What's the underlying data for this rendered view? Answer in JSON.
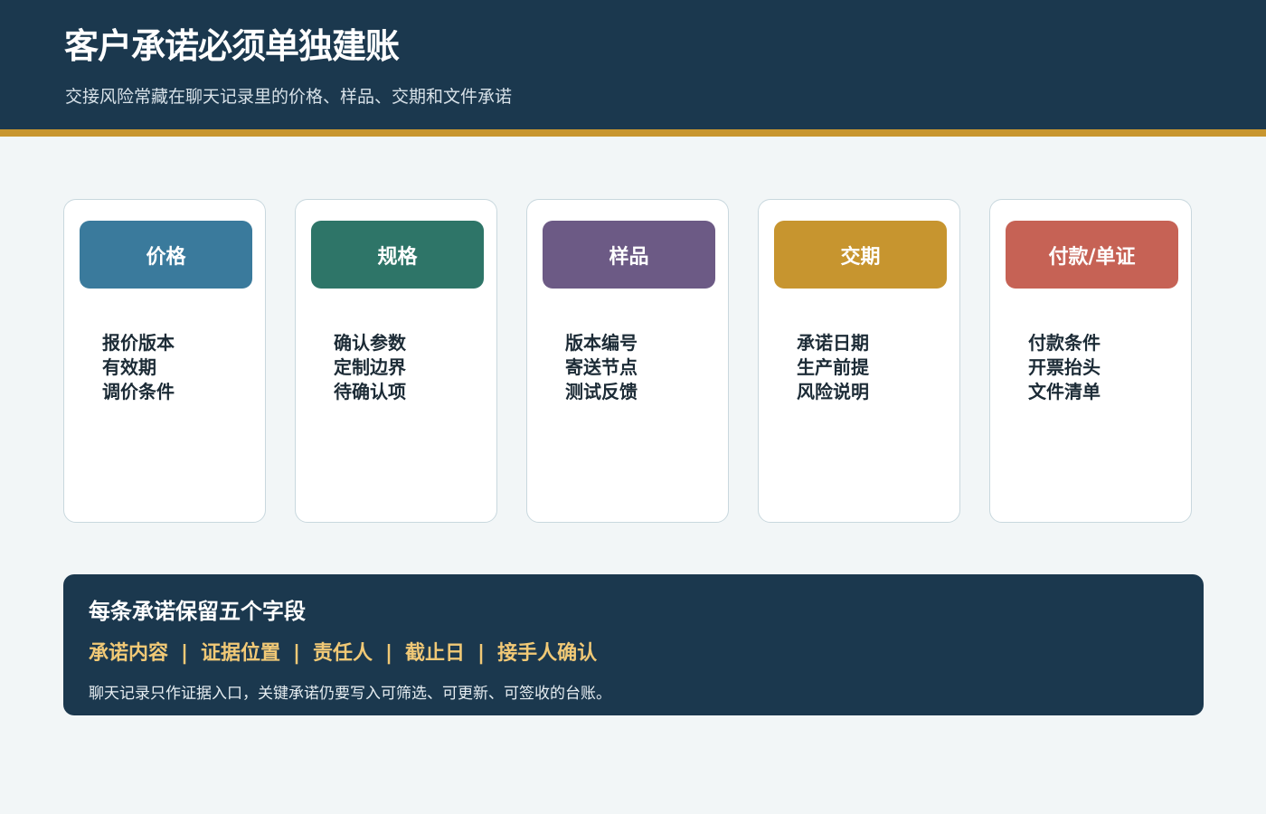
{
  "header": {
    "title": "客户承诺必须单独建账",
    "subtitle": "交接风险常藏在聊天记录里的价格、样品、交期和文件承诺"
  },
  "cards": [
    {
      "label": "价格",
      "color": "#3a7a9c",
      "items": [
        "报价版本",
        "有效期",
        "调价条件"
      ]
    },
    {
      "label": "规格",
      "color": "#2e7568",
      "items": [
        "确认参数",
        "定制边界",
        "待确认项"
      ]
    },
    {
      "label": "样品",
      "color": "#6c5a85",
      "items": [
        "版本编号",
        "寄送节点",
        "测试反馈"
      ]
    },
    {
      "label": "交期",
      "color": "#c7952f",
      "items": [
        "承诺日期",
        "生产前提",
        "风险说明"
      ]
    },
    {
      "label": "付款/单证",
      "color": "#c66255",
      "items": [
        "付款条件",
        "开票抬头",
        "文件清单"
      ]
    }
  ],
  "panel": {
    "title": "每条承诺保留五个字段",
    "fields": [
      "承诺内容",
      "证据位置",
      "责任人",
      "截止日",
      "接手人确认"
    ],
    "separator": "|",
    "note": "聊天记录只作证据入口，关键承诺仍要写入可筛选、可更新、可签收的台账。"
  }
}
